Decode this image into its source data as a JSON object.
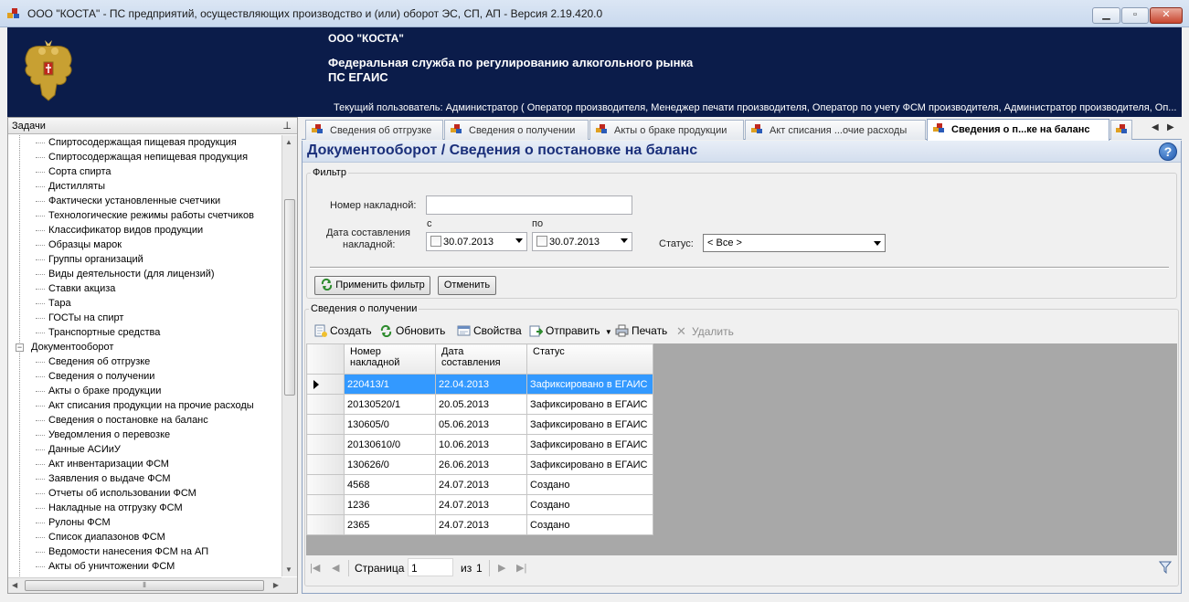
{
  "window": {
    "title": "ООО \"КОСТА\" - ПС предприятий, осуществляющих производство и (или) оборот ЭС, СП, АП - Версия 2.19.420.0",
    "minimize": "▁",
    "maximize": "▫",
    "close": "✕"
  },
  "banner": {
    "company": "ООО \"КОСТА\"",
    "fedservice": "Федеральная служба по регулированию алкогольного рынка",
    "egais": "ПС ЕГАИС",
    "current_user": "Текущий пользователь: Администратор ( Оператор производителя, Менеджер печати производителя, Оператор по учету ФСМ производителя, Администратор производителя, Оп..."
  },
  "sidebar": {
    "title": "Задачи",
    "pin": "ᵖ",
    "items_top": [
      "Спиртосодержащая пищевая продукция",
      "Спиртосодержащая непищевая продукция",
      "Сорта спирта",
      "Дистилляты",
      "Фактически установленные счетчики",
      "Технологические режимы работы счетчиков",
      "Классификатор видов продукции",
      "Образцы марок",
      "Группы организаций",
      "Виды деятельности (для лицензий)",
      "Ставки акциза",
      "Тара",
      "ГОСТы на спирт",
      "Транспортные средства"
    ],
    "group": "Документооборот",
    "group_expander": "−",
    "items_group": [
      "Сведения об отгрузке",
      "Сведения о получении",
      "Акты о браке продукции",
      "Акт списания продукции на прочие расходы",
      "Сведения о постановке на баланс",
      "Уведомления о перевозке",
      "Данные АСИиУ",
      "Акт инвентаризации ФСМ",
      "Заявления о выдаче ФСМ",
      "Отчеты об использовании ФСМ",
      "Накладные на отгрузку ФСМ",
      "Рулоны ФСМ",
      "Список диапазонов ФСМ",
      "Ведомости нанесения ФСМ на АП",
      "Акты об уничтожении ФСМ"
    ]
  },
  "tabs": [
    {
      "label": "Сведения об отгрузке"
    },
    {
      "label": "Сведения о получении"
    },
    {
      "label": "Акты о браке продукции"
    },
    {
      "label": "Акт списания ...очие расходы"
    },
    {
      "label": "Сведения о п...ке на баланс"
    }
  ],
  "page": {
    "title": "Документооборот  / Сведения о постановке на баланс",
    "help": "?"
  },
  "filter": {
    "legend": "Фильтр",
    "invoice_label": "Номер накладной:",
    "invoice_value": "",
    "date_label_line1": "Дата составления",
    "date_label_line2": "накладной:",
    "from_label": "с",
    "to_label": "по",
    "from_value": "30.07.2013",
    "to_value": "30.07.2013",
    "status_label": "Статус:",
    "status_value": "< Все >",
    "apply_label": "Применить фильтр",
    "cancel_label": "Отменить"
  },
  "grid": {
    "legend": "Сведения о получении",
    "toolbar": {
      "create": "Создать",
      "refresh": "Обновить",
      "properties": "Свойства",
      "send": "Отправить",
      "print": "Печать",
      "delete": "Удалить"
    },
    "columns": [
      "Номер накладной",
      "Дата составления",
      "Статус"
    ],
    "rows": [
      {
        "number": "220413/1",
        "date": "22.04.2013",
        "status": "Зафиксировано в ЕГАИС"
      },
      {
        "number": "20130520/1",
        "date": "20.05.2013",
        "status": "Зафиксировано в ЕГАИС"
      },
      {
        "number": "130605/0",
        "date": "05.06.2013",
        "status": "Зафиксировано в ЕГАИС"
      },
      {
        "number": "20130610/0",
        "date": "10.06.2013",
        "status": "Зафиксировано в ЕГАИС"
      },
      {
        "number": "130626/0",
        "date": "26.06.2013",
        "status": "Зафиксировано в ЕГАИС"
      },
      {
        "number": "4568",
        "date": "24.07.2013",
        "status": "Создано"
      },
      {
        "number": "1236",
        "date": "24.07.2013",
        "status": "Создано"
      },
      {
        "number": "2365",
        "date": "24.07.2013",
        "status": "Создано"
      }
    ],
    "selected_row": 0
  },
  "pager": {
    "page_label": "Страница",
    "page_value": "1",
    "of_label": "из",
    "total": "1"
  }
}
